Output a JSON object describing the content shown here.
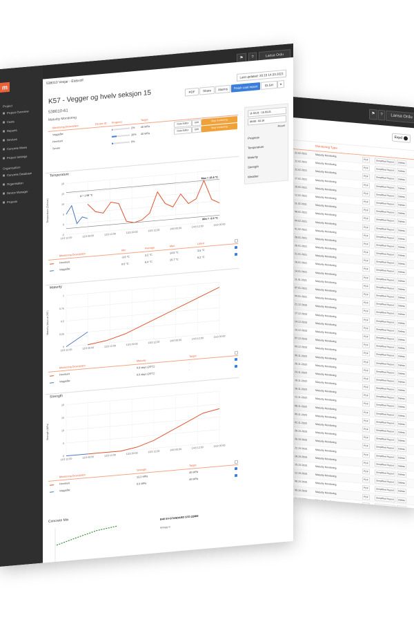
{
  "colors": {
    "accent": "#e8623a",
    "blue": "#3c7dd9",
    "dark": "#2f2f2f",
    "series_blue": "#4a78c2",
    "series_orange": "#e0532e"
  },
  "front": {
    "topbar": {
      "user": "Larisa Ordu"
    },
    "breadcrumb": "538010 Vesjar - Eidsvoll",
    "sidebar": {
      "section1": "Project",
      "items1": [
        "Project Overview",
        "Casts",
        "Reports",
        "Devices",
        "Concrete Mixes",
        "Project Settings"
      ],
      "section2": "Organisation",
      "items2": [
        "Concrete Database",
        "Organisation",
        "Device Manager",
        "Projects"
      ]
    },
    "header": {
      "last_updated": "Last updated: 20:10 14.03.2021",
      "title": "K57 - Vegger og hvelv seksjon 15",
      "subtitle": "538010-61",
      "section": "Maturity Monitoring",
      "buttons": [
        "PDF",
        "Share",
        "Alarms",
        "Finish cast report",
        "ELSH"
      ]
    },
    "monitoring": {
      "headers": [
        "Monitoring Description",
        "Device ID",
        "Progress",
        "Target"
      ],
      "rows": [
        {
          "desc": "Veggsåle",
          "progress": "2%",
          "target": "40 MPa",
          "edit": "Data Editor",
          "edit2": "Edit",
          "action": "Stop monitoring"
        },
        {
          "desc": "Hverlseit",
          "progress": "26%",
          "target": "40 MPa",
          "edit": "Data Editor",
          "edit2": "Edit",
          "action": "Stop monitoring"
        },
        {
          "desc": "Sentre",
          "progress": "8%",
          "target": ""
        }
      ]
    },
    "side_panel": {
      "date_from": "11.03.21 - 15.03.21",
      "time": "09:00 - 02:10",
      "reset": "Reset",
      "items": [
        "Progress",
        "Temperature",
        "Maturity",
        "Strength",
        "Weather"
      ]
    },
    "temperature": {
      "title": "Temperature",
      "ylabel": "Temperature (Celsius)",
      "max_label": "Max = 15.6 °C",
      "min_label": "Min = -2.0 °C",
      "mark_label": "Δ = 1.08 °C",
      "table_headers": [
        "Monitoring Description",
        "Min",
        "Average",
        "Max",
        "Latest"
      ],
      "rows": [
        {
          "desc": "Hverlseit",
          "min": "-3.6 °C",
          "avg": "3.2 °C",
          "max": "14.6 °C",
          "latest": "3.5 °C"
        },
        {
          "desc": "Veggsåle",
          "min": "0.0 °C",
          "avg": "6.4 °C",
          "max": "15.7 °C",
          "latest": "8.2 °C"
        }
      ]
    },
    "maturity": {
      "title": "Maturity",
      "ylabel": "Maturity (days at 20C)",
      "table_headers": [
        "Monitoring Description",
        "Maturity",
        "Target"
      ],
      "rows": [
        {
          "desc": "Hverlseit",
          "maturity": "0.9 days (20°C)",
          "target": "-"
        },
        {
          "desc": "Veggsåle",
          "maturity": "0.0 days (20°C)",
          "target": "-"
        }
      ]
    },
    "strength": {
      "title": "Strength",
      "ylabel": "Strength (MPa)",
      "table_headers": [
        "Monitoring Description",
        "Strength",
        "Target"
      ],
      "rows": [
        {
          "desc": "Hverlseit",
          "strength": "13.2 MPa",
          "target": "40 MPa"
        },
        {
          "desc": "Veggsåle",
          "strength": "0.0 MPa",
          "target": "40 MPa"
        }
      ]
    },
    "mix": {
      "title": "Concrete Mix",
      "std": "B40 SV-STANDARD STD 22MM",
      "sub": "Anlegg m"
    }
  },
  "back": {
    "topbar": {
      "user": "Larisa Ordu"
    },
    "toggle": "Expd",
    "table_header": "Monitoring Type",
    "rows": [
      {
        "date": "22.02.2021",
        "type": "Maturity Monitoring"
      },
      {
        "date": "22.02.2021",
        "type": "Maturity Monitoring"
      },
      {
        "date": "22.02.2021",
        "type": "Maturity Monitoring"
      },
      {
        "date": "17.02.2021",
        "type": "Maturity Monitoring"
      },
      {
        "date": "15.02.2021",
        "type": "Maturity Monitoring"
      },
      {
        "date": "12.02.2021",
        "type": "Maturity Monitoring"
      },
      {
        "date": "11.02.2021",
        "type": "Maturity Monitoring"
      },
      {
        "date": "08.02.2021",
        "type": "Maturity Monitoring"
      },
      {
        "date": "04.02.2021",
        "type": "Maturity Monitoring"
      },
      {
        "date": "01.02.2021",
        "type": "Maturity Monitoring"
      },
      {
        "date": "29.01.2021",
        "type": "Maturity Monitoring"
      },
      {
        "date": "26.01.2021",
        "type": "Maturity Monitoring"
      },
      {
        "date": "21.01.2021",
        "type": "Maturity Monitoring"
      },
      {
        "date": "18.01.2021",
        "type": "Maturity Monitoring"
      },
      {
        "date": "14.01.2021",
        "type": "Maturity Monitoring"
      },
      {
        "date": "11.01.2021",
        "type": "Maturity Monitoring"
      },
      {
        "date": "07.01.2021",
        "type": "Maturity Monitoring"
      },
      {
        "date": "04.01.2021",
        "type": "Maturity Monitoring"
      },
      {
        "date": "21.12.2020",
        "type": "Maturity Monitoring"
      },
      {
        "date": "17.12.2020",
        "type": "Maturity Monitoring"
      },
      {
        "date": "14.12.2020",
        "type": "Maturity Monitoring"
      },
      {
        "date": "10.12.2020",
        "type": "Maturity Monitoring"
      },
      {
        "date": "07.12.2020",
        "type": "Maturity Monitoring"
      },
      {
        "date": "03.12.2020",
        "type": "Maturity Monitoring"
      },
      {
        "date": "30.11.2020",
        "type": "Maturity Monitoring"
      },
      {
        "date": "26.11.2020",
        "type": "Maturity Monitoring"
      },
      {
        "date": "23.11.2020",
        "type": "Maturity Monitoring"
      },
      {
        "date": "19.11.2020",
        "type": "Maturity Monitoring"
      },
      {
        "date": "16.11.2020",
        "type": "Maturity Monitoring"
      },
      {
        "date": "12.11.2020",
        "type": "Maturity Monitoring"
      },
      {
        "date": "09.11.2020",
        "type": "Maturity Monitoring"
      },
      {
        "date": "05.11.2020",
        "type": "Maturity Monitoring"
      },
      {
        "date": "02.11.2020",
        "type": "Maturity Monitoring"
      },
      {
        "date": "29.10.2020",
        "type": "Maturity Monitoring"
      },
      {
        "date": "26.10.2020",
        "type": "Maturity Monitoring"
      },
      {
        "date": "22.10.2020",
        "type": "Maturity Monitoring"
      },
      {
        "date": "19.10.2020",
        "type": "Maturity Monitoring"
      },
      {
        "date": "15.10.2020",
        "type": "Maturity Monitoring"
      },
      {
        "date": "12.10.2020",
        "type": "Maturity Monitoring"
      },
      {
        "date": "08.10.2020",
        "type": "Maturity Monitoring"
      },
      {
        "date": "05.10.2020",
        "type": "Maturity Monitoring"
      },
      {
        "date": "01.10.2020",
        "type": "Maturity Monitoring"
      },
      {
        "date": "28.09.2020",
        "type": "Maturity Monitoring"
      },
      {
        "date": "24.09.2020",
        "type": "Maturity Monitoring"
      },
      {
        "date": "21.09.2020",
        "type": "Maturity Monitoring"
      }
    ],
    "row_actions": [
      "PDF",
      "Simplified Report",
      "Delete"
    ]
  },
  "chart_data": [
    {
      "type": "line",
      "title": "Temperature",
      "x_ticks": [
        "11/3 12:00",
        "12/3 00:00",
        "12/3 12:00",
        "13/3 00:00",
        "13/3 12:00",
        "14/3 00:00",
        "14/3 12:00",
        "15/3 00:00"
      ],
      "ylim": [
        -5,
        20
      ],
      "y_ticks": [
        -5,
        0,
        5,
        10,
        15,
        20
      ],
      "series": [
        {
          "name": "Hverlseit",
          "values": [
            9,
            5,
            4,
            9,
            8,
            -1,
            -2,
            -1,
            2,
            12,
            6,
            4,
            10,
            5,
            7,
            15.6,
            6,
            4
          ]
        },
        {
          "name": "Veggsåle",
          "values": [
            5,
            9,
            0,
            3,
            2
          ]
        }
      ]
    },
    {
      "type": "line",
      "title": "Maturity",
      "x_ticks": [
        "11/3 12:00",
        "12/3 00:00",
        "12/3 12:00",
        "13/3 00:00",
        "13/3 12:00",
        "14/3 00:00",
        "14/3 12:00",
        "15/3 00:00"
      ],
      "ylim": [
        0,
        1
      ],
      "y_ticks": [
        0,
        0.25,
        0.5,
        0.75,
        1
      ],
      "series": [
        {
          "name": "Hverlseit",
          "values": [
            0,
            0.05,
            0.15,
            0.3,
            0.45,
            0.6,
            0.75,
            0.9
          ]
        },
        {
          "name": "Veggsåle",
          "values": [
            0,
            0.25
          ]
        }
      ]
    },
    {
      "type": "line",
      "title": "Strength",
      "x_ticks": [
        "11/3 12:00",
        "12/3 00:00",
        "12/3 12:00",
        "13/3 00:00",
        "13/3 12:00",
        "14/3 00:00",
        "14/3 12:00",
        "15/3 00:00"
      ],
      "ylim": [
        0,
        20
      ],
      "y_ticks": [
        0,
        5,
        10,
        15,
        20
      ],
      "series": [
        {
          "name": "Hverlseit",
          "values": [
            0,
            0,
            0,
            1,
            3,
            6,
            9,
            12,
            13.2
          ]
        },
        {
          "name": "Veggsåle",
          "values": [
            0,
            0
          ]
        }
      ]
    }
  ]
}
